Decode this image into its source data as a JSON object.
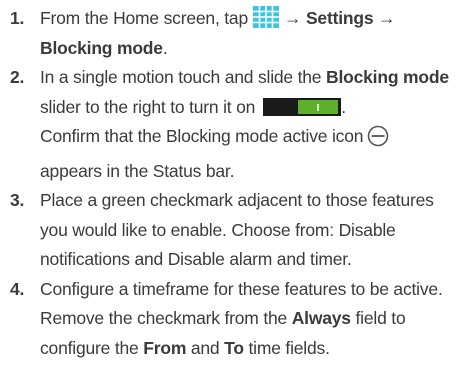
{
  "steps": [
    {
      "number": "1.",
      "lines": [
        {
          "pre": "From the Home screen, tap",
          "icon": "apps-grid-icon",
          "post_bold": "→ Settings →"
        },
        {
          "bold": "Blocking mode",
          "post": "."
        }
      ]
    },
    {
      "number": "2.",
      "lines": [
        {
          "pre": "In a single motion touch and slide the ",
          "bold": "Blocking mode"
        },
        {
          "pre": "slider to the right to turn it on",
          "icon": "on-toggle-icon",
          "post": "."
        },
        {
          "pre": "Confirm that the Blocking mode active icon",
          "icon": "blocking-mode-icon"
        },
        {
          "pre": "appears in the Status bar."
        }
      ]
    },
    {
      "number": "3.",
      "lines": [
        {
          "pre": "Place a green checkmark adjacent to those features"
        },
        {
          "pre": "you would like to enable. Choose from: Disable"
        },
        {
          "pre": "notifications and Disable alarm and timer."
        }
      ]
    },
    {
      "number": "4.",
      "lines": [
        {
          "pre": "Configure a timeframe for these features to be active."
        },
        {
          "pre": "Remove the checkmark from the ",
          "bold": "Always",
          "post": " field to"
        },
        {
          "pre": "configure the ",
          "bold": "From",
          "mid": " and ",
          "bold2": "To",
          "post": " time fields."
        }
      ]
    }
  ],
  "colors": {
    "text": "#3b3b3b",
    "apps_icon": "#3cc5e0",
    "toggle_on": "#5fae2c",
    "toggle_bg": "#1a1a1a"
  }
}
